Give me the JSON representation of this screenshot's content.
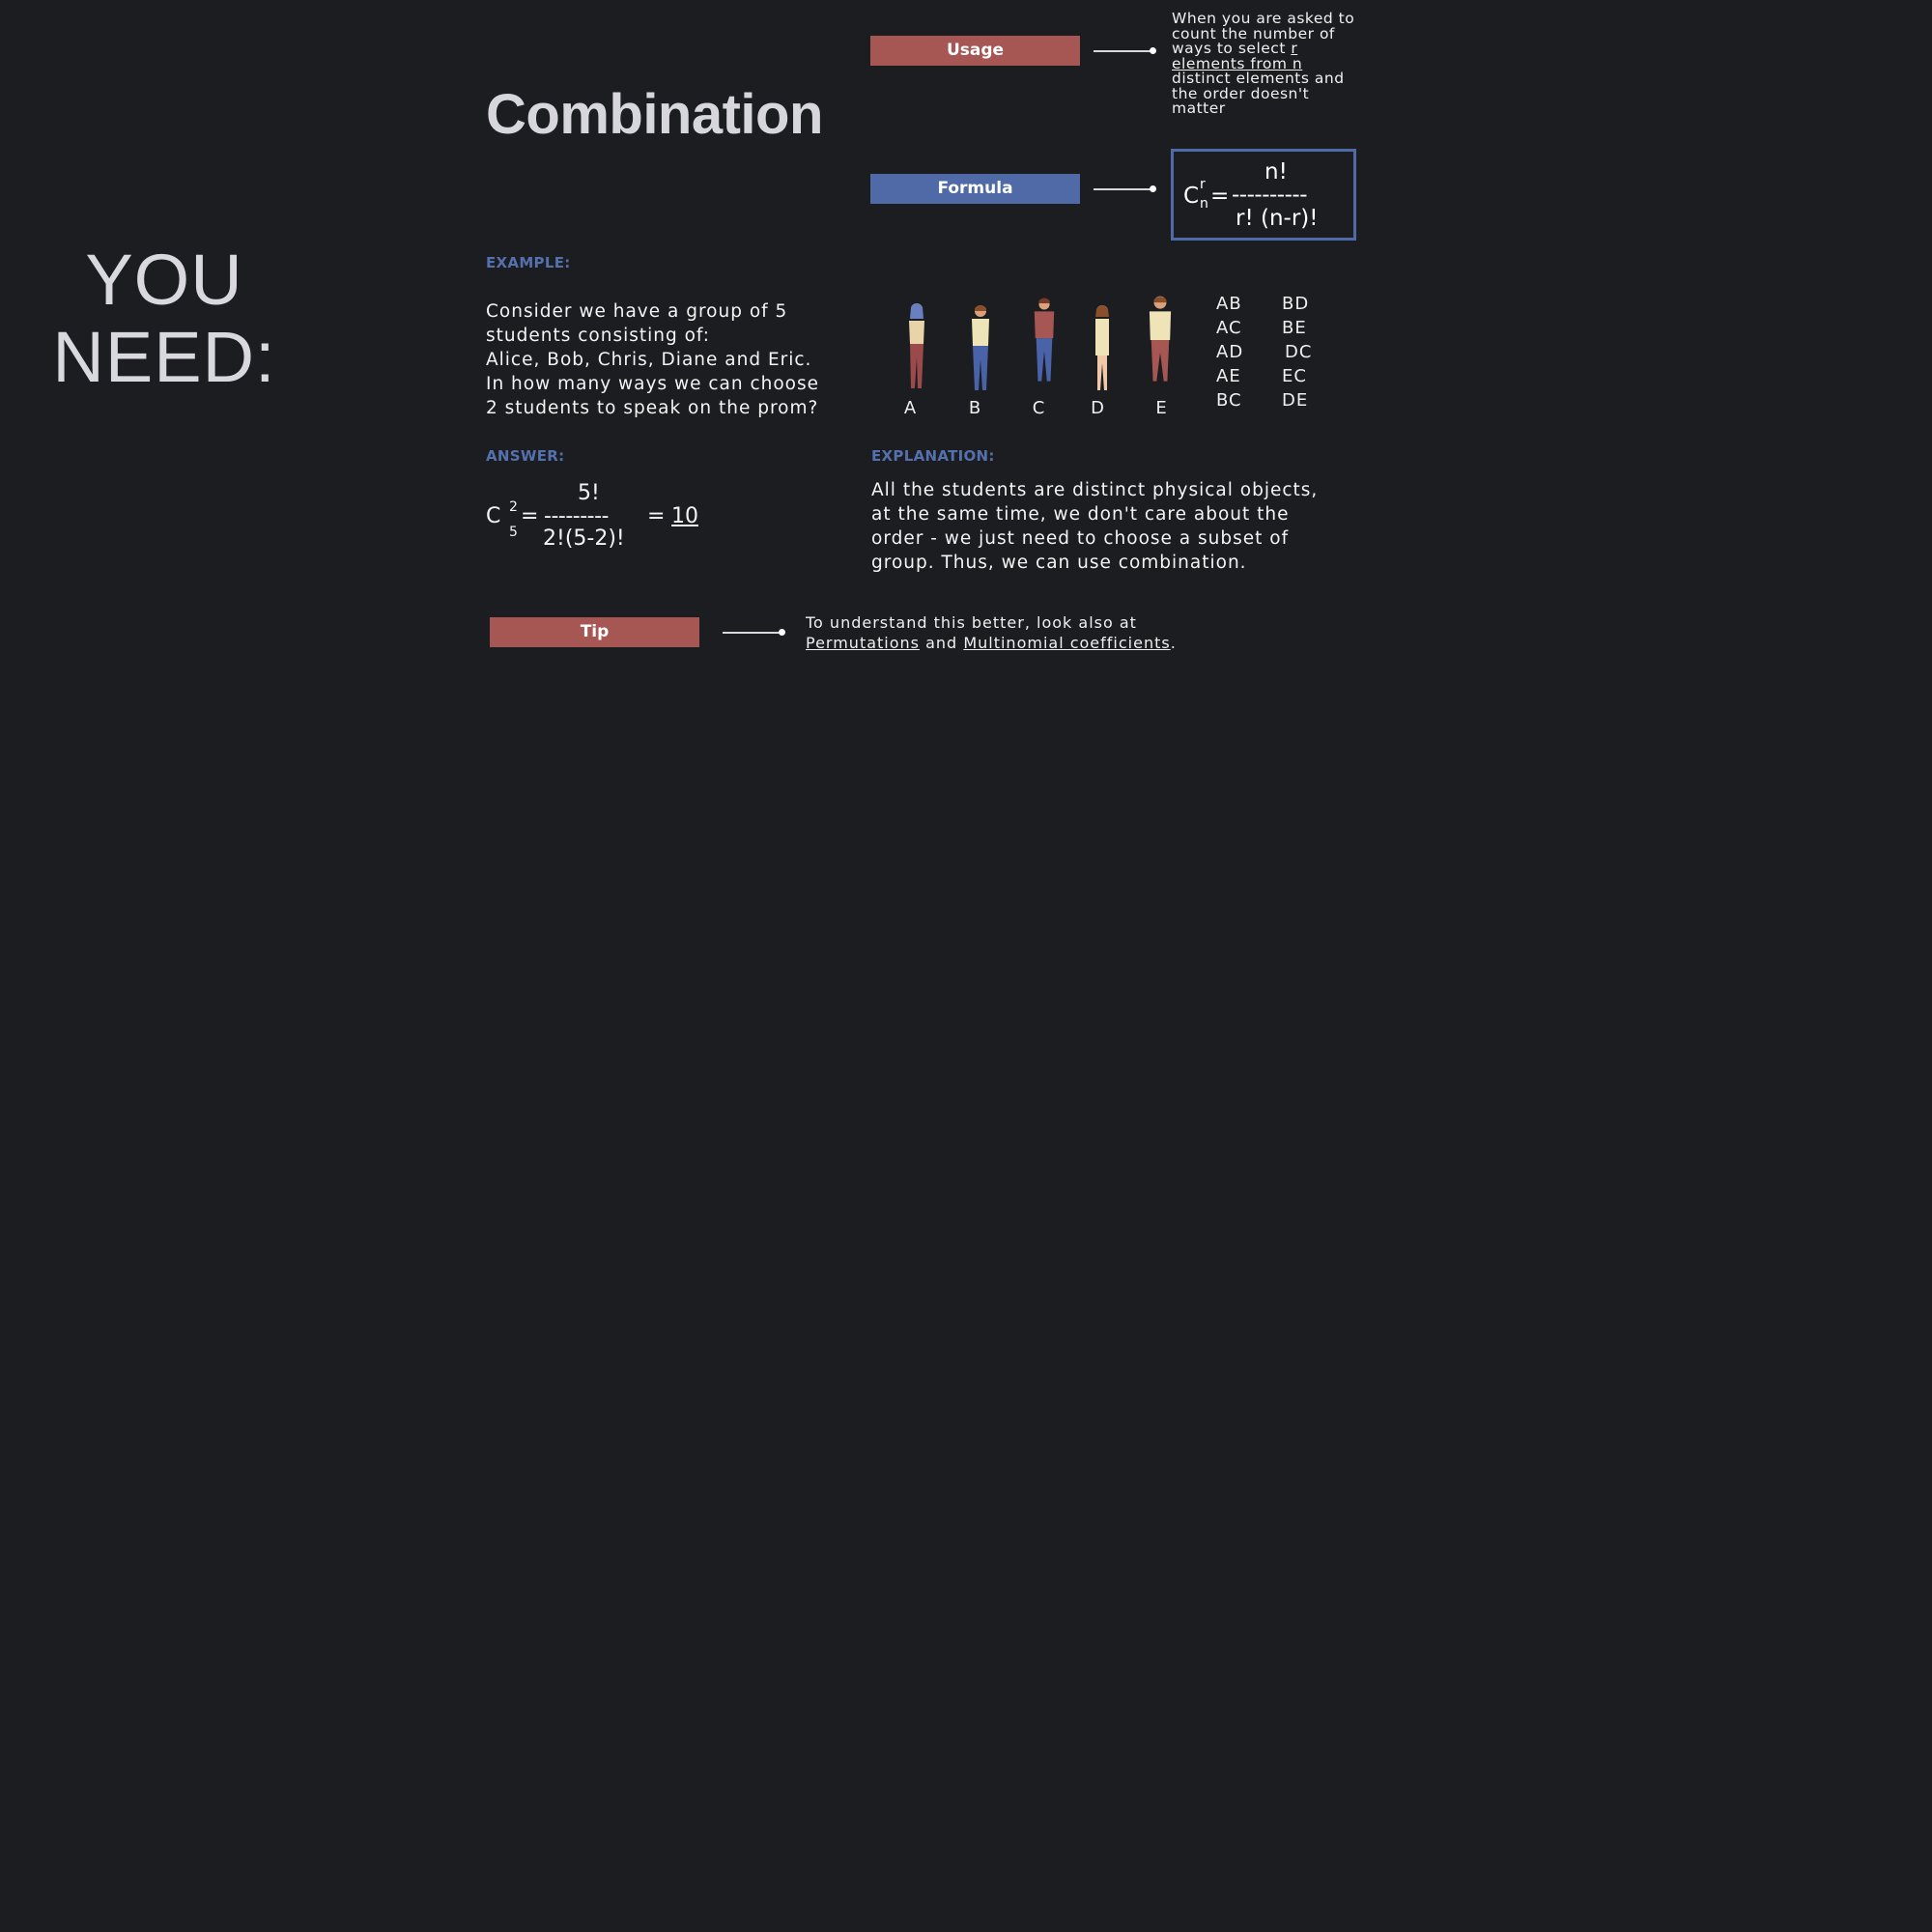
{
  "side": {
    "line1": "YOU",
    "line2": "NEED:"
  },
  "title": "Combination",
  "usage": {
    "tag": "Usage",
    "text_before": "When you are asked to count the number of ways to select ",
    "text_underlined": "r elements from n",
    "text_after": " distinct elements and the order doesn't matter"
  },
  "formula": {
    "tag": "Formula",
    "c": "C",
    "sup": "r",
    "sub": "n",
    "eq": "=",
    "numerator": "n!",
    "dashes": "----------",
    "denominator": "r! (n-r)!"
  },
  "example": {
    "label": "EXAMPLE:",
    "lines": [
      "Consider we have a group of 5",
      "students consisting of:",
      "Alice, Bob, Chris, Diane and Eric.",
      "In how many ways we can choose",
      "2 students to  speak on the prom?"
    ]
  },
  "students": [
    {
      "label": "A",
      "top": "#e8d4a8",
      "bottom": "#9a4a4a",
      "hair": "#6a7fc0"
    },
    {
      "label": "B",
      "top": "#efe3b8",
      "bottom": "#4a63a8",
      "hair": "#8a4f2a"
    },
    {
      "label": "C",
      "top": "#a65653",
      "bottom": "#4a63a8",
      "hair": "#7a3a2a"
    },
    {
      "label": "D",
      "top": "#efe3b8",
      "bottom": "#efe3b8",
      "hair": "#8a4f2a"
    },
    {
      "label": "E",
      "top": "#efe3b8",
      "bottom": "#a65653",
      "hair": "#8a4f2a"
    }
  ],
  "pairs": {
    "left": [
      "AB",
      "AC",
      "AD",
      "AE",
      "BC"
    ],
    "right": [
      "BD",
      "BE",
      "DC",
      "EC",
      "DE"
    ]
  },
  "answer": {
    "label": "ANSWER:",
    "c": "C",
    "sup": "2",
    "sub": "5",
    "eq": "=",
    "numerator": "5!",
    "dashes": "---------",
    "denominator": "2!(5-2)!",
    "eq2": "=",
    "result": "10"
  },
  "explanation": {
    "label": "EXPLANATION:",
    "lines": [
      "All the students are distinct physical objects,",
      "at the same time, we don't care about the",
      "order - we just need to choose a subset of",
      "group. Thus, we can use combination."
    ]
  },
  "tip": {
    "tag": "Tip",
    "line1": "To understand this better, look also at",
    "link1": "Permutations",
    "and": "and",
    "link2": "Multinomial coefficients",
    "period": "."
  },
  "colors": {
    "background": "#1c1d21",
    "accent_red": "#a65653",
    "accent_blue": "#4f6aa6",
    "label_blue": "#5470ad"
  }
}
